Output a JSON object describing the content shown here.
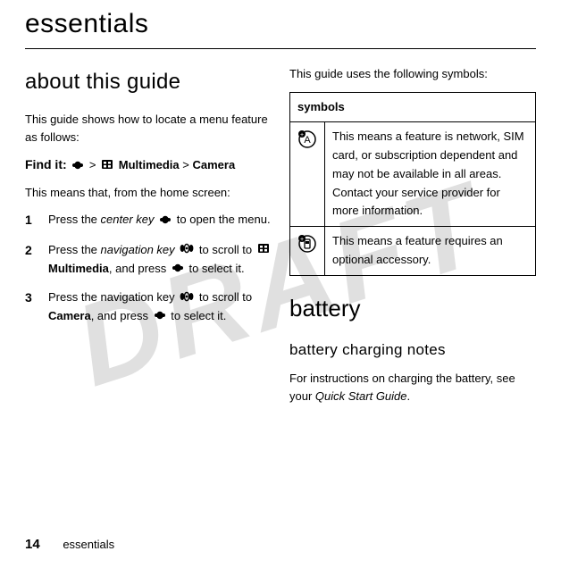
{
  "watermark": "DRAFT",
  "chapter_title": "essentials",
  "left": {
    "section_title": "about this guide",
    "intro": "This guide shows how to locate a menu feature as follows:",
    "find_it_lead": "Find it:",
    "find_it_sep1": " > ",
    "find_it_item1": " Multimedia",
    "find_it_sep2": " > ",
    "find_it_item2": "Camera",
    "means": "This means that, from the home screen:",
    "steps": [
      {
        "num": "1",
        "pre": "Press the ",
        "italic": "center key",
        "post": " to open the menu."
      },
      {
        "num": "2",
        "pre": "Press the ",
        "italic": "navigation key",
        "mid": " to scroll to ",
        "bold": "Multimedia",
        "post2": ", and press ",
        "tail": " to select it."
      },
      {
        "num": "3",
        "pre": "Press the navigation key ",
        "mid": " to scroll to ",
        "bold": "Camera",
        "post2": ", and press ",
        "tail": " to select it."
      }
    ]
  },
  "right": {
    "intro": "This guide uses the following symbols:",
    "table_header": "symbols",
    "rows": [
      {
        "text": "This means a feature is network, SIM card, or subscription dependent and may not be available in all areas. Contact your service provider for more information."
      },
      {
        "text": "This means a feature requires an optional accessory."
      }
    ],
    "battery_title": "battery",
    "notes_title": "battery charging notes",
    "notes_pre": "For instructions on charging the battery, see your ",
    "notes_italic": "Quick Start Guide",
    "notes_post": "."
  },
  "footer": {
    "page": "14",
    "label": "essentials"
  }
}
